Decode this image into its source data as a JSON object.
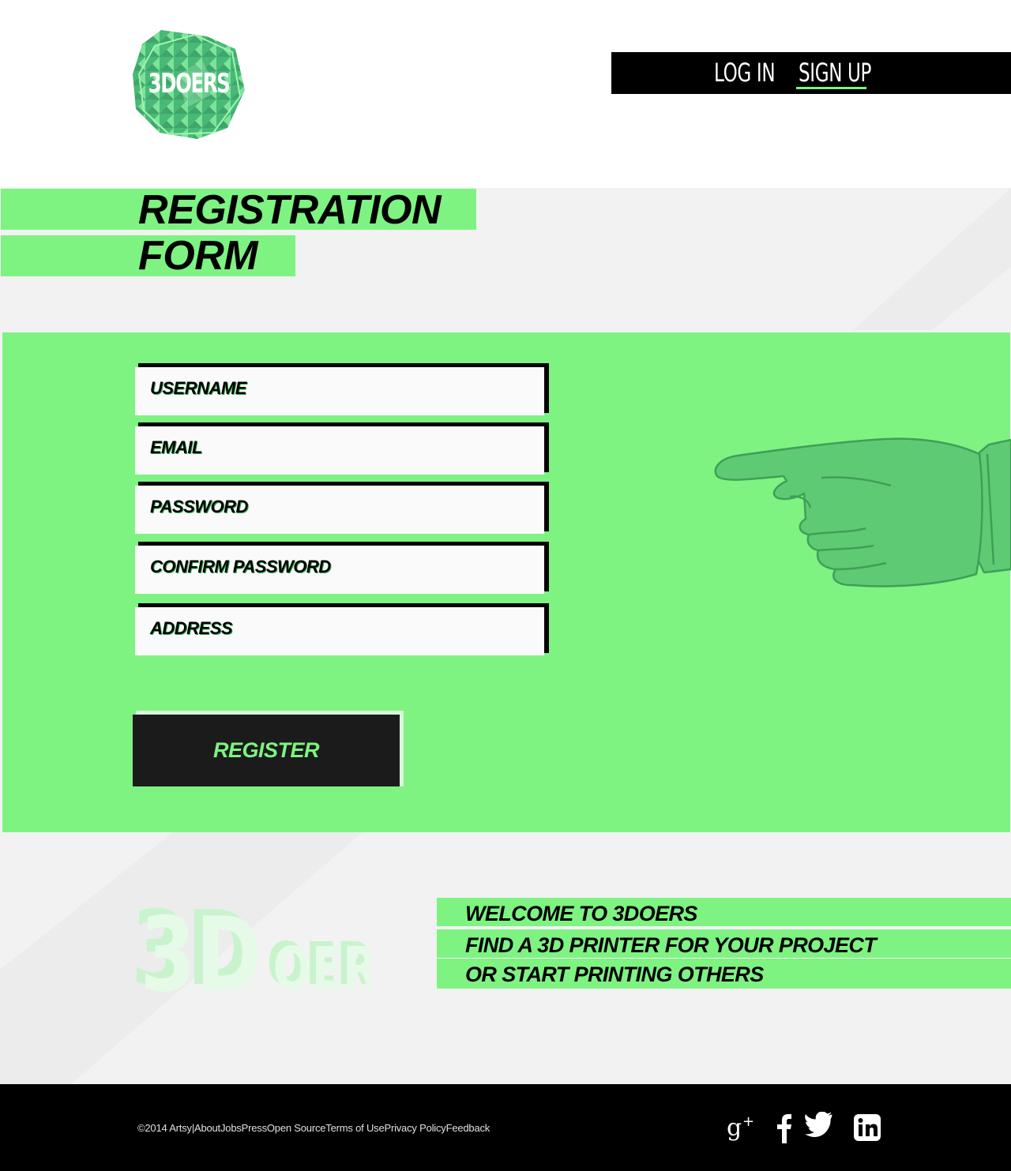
{
  "header": {
    "logo_text": "3DOERS",
    "nav": {
      "login": "LOG IN",
      "signup": "SIGN UP",
      "active": "signup"
    }
  },
  "title": {
    "line1": "REGISTRATION",
    "line2": "FORM"
  },
  "form": {
    "fields": [
      {
        "label": "USERNAME"
      },
      {
        "label": "EMAIL"
      },
      {
        "label": "PASSWORD"
      },
      {
        "label": "CONFIRM PASSWORD"
      },
      {
        "label": "ADDRESS"
      }
    ],
    "submit_label": "REGISTER"
  },
  "welcome": {
    "lines": [
      "WELCOME TO 3DOERS",
      "FIND A 3D PRINTER FOR YOUR  PROJECT",
      "OR START PRINTING  OTHERS"
    ],
    "logo_3d_text": "3DOERS"
  },
  "footer": {
    "copyright": "©2014 Artsy",
    "separator": "|",
    "links": [
      "About",
      "Jobs",
      "Press",
      "Open Source",
      "Terms of Use",
      "Privacy Policy",
      "Feedback"
    ],
    "social_icons": [
      "google-plus-icon",
      "facebook-icon",
      "twitter-icon",
      "linkedin-icon"
    ]
  },
  "colors": {
    "accent": "#7ef382",
    "dark": "#000000",
    "button": "#1b1b1b",
    "band": "#f2f2f2"
  }
}
